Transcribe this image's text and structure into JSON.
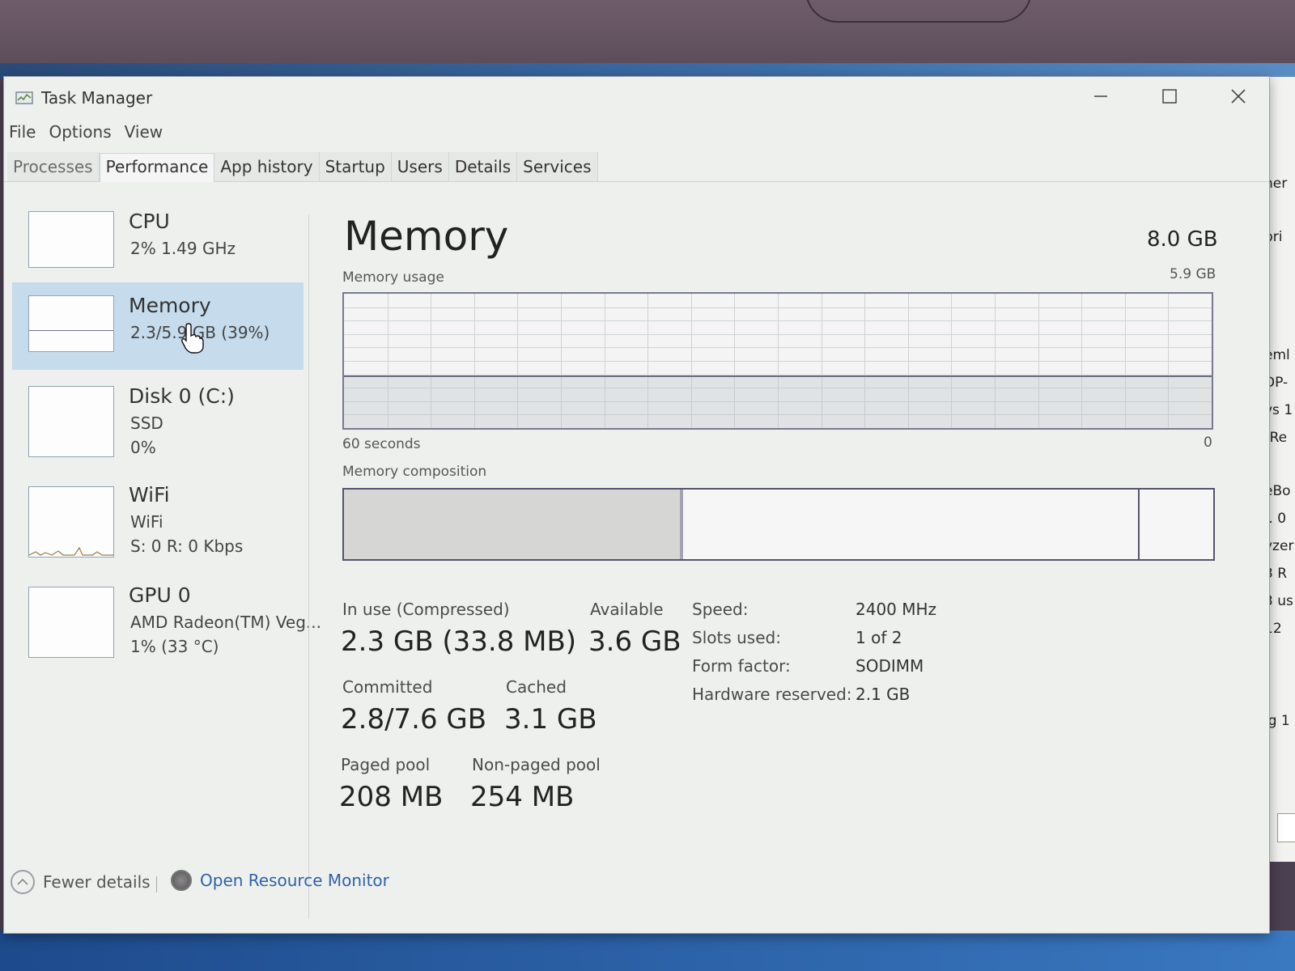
{
  "window": {
    "title": "Task Manager",
    "min_icon": "minimize-icon",
    "max_icon": "maximize-icon",
    "close_icon": "close-icon"
  },
  "menu": [
    "File",
    "Options",
    "View"
  ],
  "tabs": [
    "Processes",
    "Performance",
    "App history",
    "Startup",
    "Users",
    "Details",
    "Services"
  ],
  "sidebar": {
    "items": [
      {
        "title": "CPU",
        "line1": "2%  1.49 GHz",
        "line2": ""
      },
      {
        "title": "Memory",
        "line1": "2.3/5.9 GB (39%)",
        "line2": ""
      },
      {
        "title": "Disk 0 (C:)",
        "line1": "SSD",
        "line2": "0%"
      },
      {
        "title": "WiFi",
        "line1": "WiFi",
        "line2": "S: 0  R: 0 Kbps"
      },
      {
        "title": "GPU 0",
        "line1": "AMD Radeon(TM) Veg...",
        "line2": "1%  (33 °C)"
      }
    ]
  },
  "main": {
    "title": "Memory",
    "total": "8.0 GB",
    "usage_label": "Memory usage",
    "usage_max": "5.9 GB",
    "usage_fraction": 0.39,
    "axis_left": "60 seconds",
    "axis_right": "0",
    "composition_label": "Memory composition",
    "composition": {
      "in_use_gb": 2.3,
      "modified_gb": 0.0,
      "standby_gb": 3.1,
      "free_gb": 0.5
    },
    "stats": {
      "in_use_label": "In use (Compressed)",
      "in_use_value": "2.3 GB (33.8 MB)",
      "available_label": "Available",
      "available_value": "3.6 GB",
      "committed_label": "Committed",
      "committed_value": "2.8/7.6 GB",
      "cached_label": "Cached",
      "cached_value": "3.1 GB",
      "paged_label": "Paged pool",
      "paged_value": "208 MB",
      "nonpaged_label": "Non-paged pool",
      "nonpaged_value": "254 MB"
    },
    "props": {
      "speed_label": "Speed:",
      "speed_value": "2400 MHz",
      "slots_label": "Slots used:",
      "slots_value": "1 of 2",
      "form_label": "Form factor:",
      "form_value": "SODIMM",
      "reserved_label": "Hardware reserved:",
      "reserved_value": "2.1 GB"
    }
  },
  "footer": {
    "fewer": "Fewer details",
    "resmon": "Open Resource Monitor"
  },
  "bg_window_fragments": [
    "ner",
    "pri",
    "eml",
    "DP-",
    "vs 1",
    "(Re",
    "eBo",
    "r. 0",
    "yzer",
    "3 R",
    "3 us",
    "12",
    "ıg 1"
  ],
  "colors": {
    "selected": "#c6dbeb",
    "link": "#2e63a8",
    "graph_border": "#7a7891"
  }
}
